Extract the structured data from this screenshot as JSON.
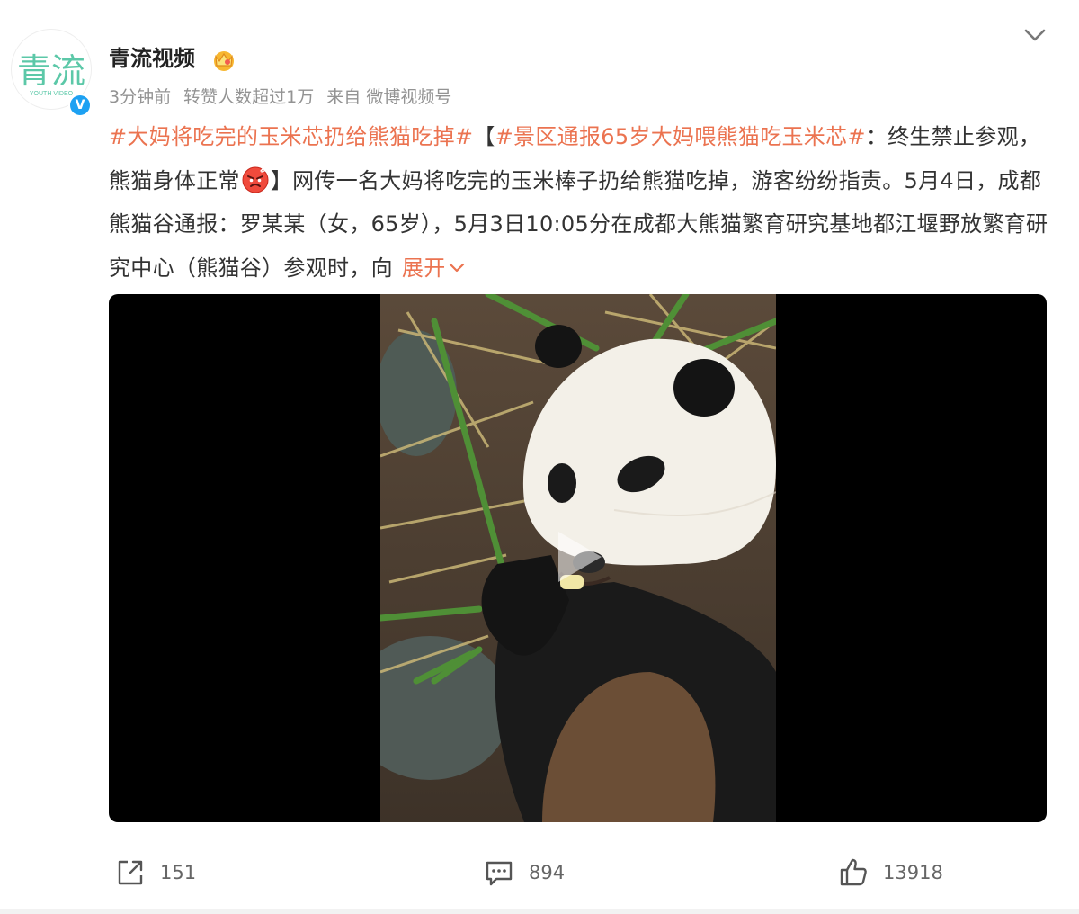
{
  "author": {
    "name": "青流视频",
    "avatar_text": "青流",
    "avatar_subtext": "YOUTH VIDEO",
    "badge_icon": "crown-icon",
    "verified_icon": "verified-icon",
    "verified_mark": "V"
  },
  "meta": {
    "time": "3分钟前",
    "likes_note": "转赞人数超过1万",
    "source": "来自 微博视频号"
  },
  "post": {
    "tag1": "#大妈将吃完的玉米芯扔给熊猫吃掉#",
    "bracket_open": "【",
    "tag2": "#景区通报65岁大妈喂熊猫吃玉米芯#",
    "text1": "：终生禁止参观，熊猫身体正常",
    "emoji": "angry-face-emoji",
    "text2": "】网传一名大妈将吃完的玉米棒子扔给熊猫吃掉，游客纷纷指责。5月4日，成都熊猫谷通报：罗某某（女，65岁），5月3日10:05分在成都大熊猫繁育研究基地都江堰野放繁育研究中心（熊猫谷）参观时，向",
    "expand_label": "展开"
  },
  "actions": {
    "share_count": "151",
    "comment_count": "894",
    "like_count": "13918"
  },
  "colors": {
    "link": "#eb7350",
    "text": "#333333",
    "meta": "#939393",
    "avatar_green": "#5cc8a8"
  }
}
